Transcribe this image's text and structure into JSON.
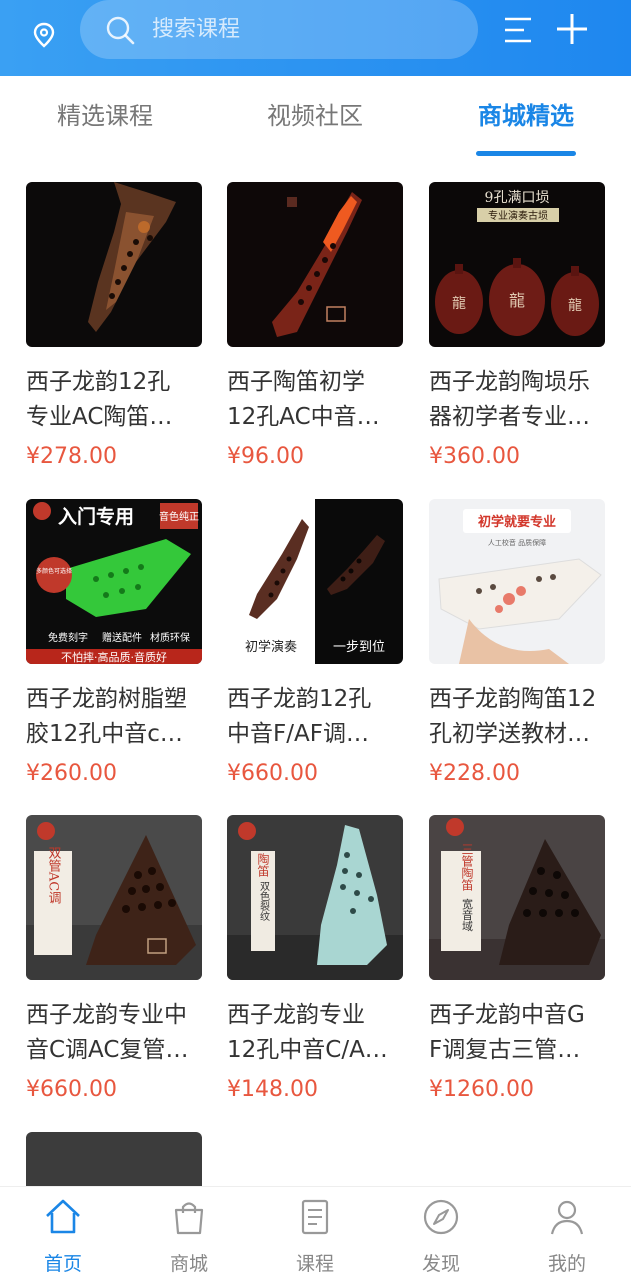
{
  "search": {
    "placeholder": "搜索课程"
  },
  "tabs": [
    {
      "label": "精选课程",
      "active": false
    },
    {
      "label": "视频社区",
      "active": false
    },
    {
      "label": "商城精选",
      "active": true
    }
  ],
  "products": [
    {
      "title_line1": "西子龙韵12孔",
      "title_line2": "专业AC陶笛…",
      "price": "¥278.00"
    },
    {
      "title_line1": "西子陶笛初学",
      "title_line2": "12孔AC中音…",
      "price": "¥96.00"
    },
    {
      "title_line1": "西子龙韵陶埙乐",
      "title_line2": "器初学者专业…",
      "price": "¥360.00",
      "image_text": [
        "9孔满口埙",
        "专业演奏古埙",
        "龍",
        "龍",
        "龍"
      ]
    },
    {
      "title_line1": "西子龙韵树脂塑",
      "title_line2": "胶12孔中音c…",
      "price": "¥260.00",
      "image_text": [
        "入门专用",
        "音色纯正",
        "多颜色可选择",
        "免费刻字",
        "赠送配件",
        "材质环保",
        "不怕摔·高品质·音质好"
      ]
    },
    {
      "title_line1": "西子龙韵12孔",
      "title_line2": "中音F/AF调…",
      "price": "¥660.00",
      "image_text": [
        "初学演奏",
        "一步到位"
      ]
    },
    {
      "title_line1": "西子龙韵陶笛12",
      "title_line2": "孔初学送教材…",
      "price": "¥228.00",
      "image_text": [
        "初学就要专业",
        "人工校音  品质保障"
      ]
    },
    {
      "title_line1": "西子龙韵专业中",
      "title_line2": "音C调AC复管…",
      "price": "¥660.00",
      "image_text": [
        "双管AC调"
      ]
    },
    {
      "title_line1": "西子龙韵专业",
      "title_line2": "12孔中音C/A…",
      "price": "¥148.00",
      "image_text": [
        "陶笛",
        "双色裂纹"
      ]
    },
    {
      "title_line1": "西子龙韵中音G",
      "title_line2": "F调复古三管…",
      "price": "¥1260.00",
      "image_text": [
        "三管陶笛",
        "宽音域"
      ]
    }
  ],
  "bottom_nav": [
    {
      "label": "首页",
      "icon": "home-icon",
      "active": true
    },
    {
      "label": "商城",
      "icon": "shopping-bag-icon",
      "active": false
    },
    {
      "label": "课程",
      "icon": "course-book-icon",
      "active": false
    },
    {
      "label": "发现",
      "icon": "compass-icon",
      "active": false
    },
    {
      "label": "我的",
      "icon": "user-icon",
      "active": false
    }
  ],
  "colors": {
    "accent": "#1a86e6",
    "price": "#e8573f",
    "topbar": "#2a93f0"
  }
}
